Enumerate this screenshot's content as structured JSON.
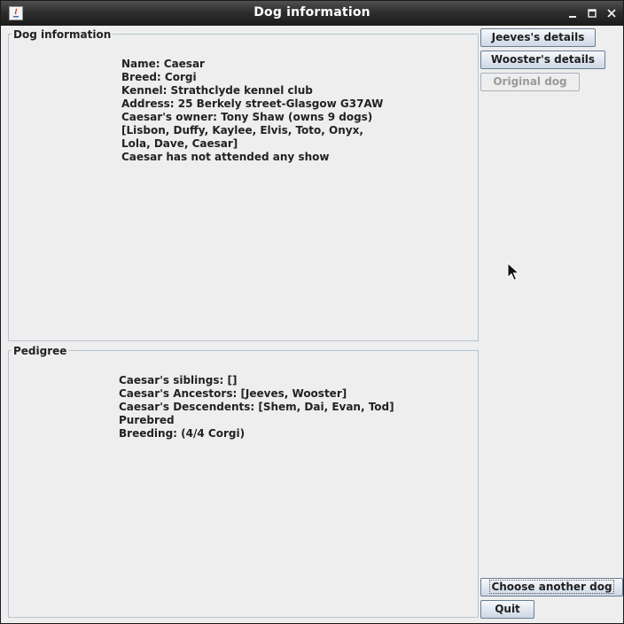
{
  "window": {
    "title": "Dog information",
    "minimize_icon": "minimize-icon",
    "maximize_icon": "maximize-icon",
    "close_icon": "close-icon"
  },
  "dog_panel": {
    "legend": "Dog information",
    "lines": [
      "Name: Caesar",
      "Breed: Corgi",
      "Kennel: Strathclyde kennel club",
      "Address: 25 Berkely street-Glasgow G37AW",
      "Caesar's owner: Tony Shaw (owns 9 dogs)",
      "[Lisbon, Duffy, Kaylee, Elvis, Toto, Onyx,",
      "Lola, Dave, Caesar]",
      "Caesar has not attended any show"
    ]
  },
  "pedigree_panel": {
    "legend": "Pedigree",
    "lines": [
      "Caesar's siblings: []",
      "Caesar's Ancestors: [Jeeves, Wooster]",
      "Caesar's Descendents: [Shem, Dai, Evan, Tod]",
      "Purebred",
      "Breeding: (4/4 Corgi)"
    ]
  },
  "buttons": {
    "jeeves": "Jeeves's details",
    "wooster": "Wooster's details",
    "original": "Original dog",
    "choose": "Choose another dog",
    "quit": "Quit"
  }
}
